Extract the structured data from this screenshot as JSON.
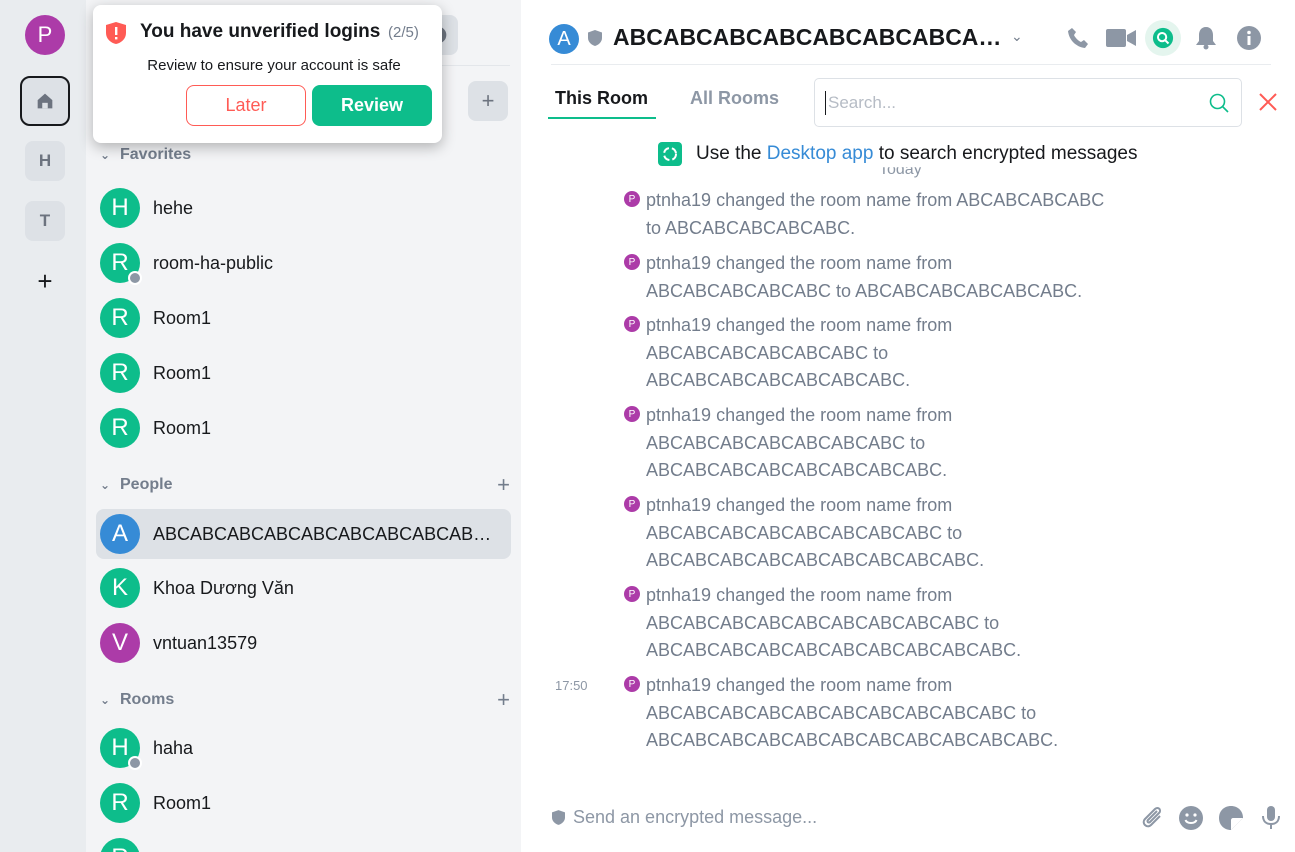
{
  "spaces": {
    "user_initial": "P",
    "user_color": "#ac3ba8",
    "items": [
      {
        "label": "H"
      },
      {
        "label": "T"
      }
    ],
    "add_label": "+"
  },
  "toast": {
    "title": "You have unverified logins",
    "count": "(2/5)",
    "description": "Review to ensure your account is safe",
    "later_label": "Later",
    "review_label": "Review"
  },
  "sections": {
    "favorites": "Favorites",
    "people": "People",
    "rooms": "Rooms"
  },
  "favorites": [
    {
      "initial": "H",
      "name": "hehe",
      "color": "#0dbd8b"
    },
    {
      "initial": "R",
      "name": "room-ha-public",
      "color": "#0dbd8b"
    },
    {
      "initial": "R",
      "name": "Room1",
      "color": "#0dbd8b"
    },
    {
      "initial": "R",
      "name": "Room1",
      "color": "#0dbd8b"
    },
    {
      "initial": "R",
      "name": "Room1",
      "color": "#0dbd8b"
    }
  ],
  "people": [
    {
      "initial": "A",
      "name": "ABCABCABCABCABCABCABCABCABCABC",
      "color": "#368bd6"
    },
    {
      "initial": "K",
      "name": "Khoa Dương Văn",
      "color": "#0dbd8b"
    },
    {
      "initial": "V",
      "name": "vntuan13579",
      "color": "#ac3ba8"
    }
  ],
  "rooms": [
    {
      "initial": "H",
      "name": "haha",
      "color": "#0dbd8b"
    },
    {
      "initial": "R",
      "name": "Room1",
      "color": "#0dbd8b"
    },
    {
      "initial": "R",
      "name": "",
      "color": "#0dbd8b"
    }
  ],
  "header": {
    "avatar_initial": "A",
    "title": "ABCABCABCABCABCABCABCABCABCABC"
  },
  "search": {
    "tab_this_room": "This Room",
    "tab_all_rooms": "All Rooms",
    "placeholder": "Search...",
    "info_prefix": "Use the",
    "info_link": "Desktop app",
    "info_suffix": "to search encrypted messages",
    "date_separator": "Today"
  },
  "events": [
    {
      "avatar": "P",
      "text": "ptnha19 changed the room name from ABCABCABCABC to ABCABCABCABCABC."
    },
    {
      "avatar": "P",
      "text": "ptnha19 changed the room name from ABCABCABCABCABC to ABCABCABCABCABCABC."
    },
    {
      "avatar": "P",
      "text": "ptnha19 changed the room name from ABCABCABCABCABCABC to ABCABCABCABCABCABCABC."
    },
    {
      "avatar": "P",
      "text": "ptnha19 changed the room name from ABCABCABCABCABCABCABC to ABCABCABCABCABCABCABCABC."
    },
    {
      "avatar": "P",
      "text": "ptnha19 changed the room name from ABCABCABCABCABCABCABCABC to ABCABCABCABCABCABCABCABCABC."
    },
    {
      "avatar": "P",
      "text": "ptnha19 changed the room name from ABCABCABCABCABCABCABCABCABC to ABCABCABCABCABCABCABCABCABCABC."
    },
    {
      "avatar": "P",
      "text": "ptnha19 changed the room name from ABCABCABCABCABCABCABCABCABCABC to ABCABCABCABCABCABCABCABCABCABCABC."
    }
  ],
  "last_event_time": "17:50",
  "composer": {
    "placeholder": "Send an encrypted message..."
  },
  "colors": {
    "accent": "#0dbd8b",
    "alert": "#ff5b55",
    "link": "#368bd6"
  }
}
